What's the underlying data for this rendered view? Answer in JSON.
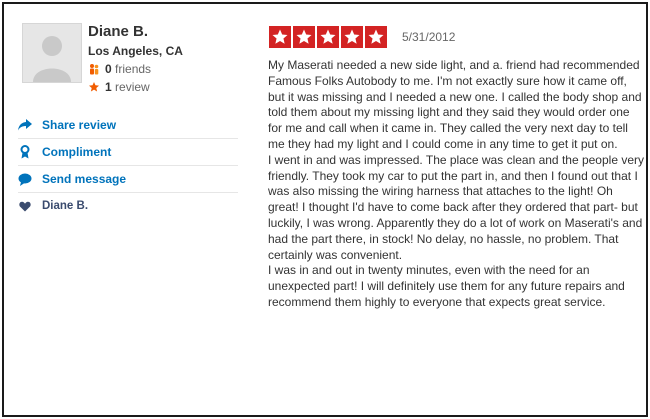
{
  "user": {
    "name": "Diane B.",
    "location": "Los Angeles, CA",
    "friends_count": "0",
    "friends_label": "friends",
    "reviews_count": "1",
    "reviews_label": "review"
  },
  "actions": [
    {
      "label": "Share review",
      "icon": "share-arrow-icon"
    },
    {
      "label": "Compliment",
      "icon": "award-ribbon-icon"
    },
    {
      "label": "Send message",
      "icon": "speech-bubble-icon"
    },
    {
      "label": "Diane B.",
      "icon": "heart-icon"
    }
  ],
  "review": {
    "rating": 5,
    "rating_max": 5,
    "date": "5/31/2012",
    "paragraphs": [
      "My Maserati needed a new side light, and a. friend had recommended Famous Folks Autobody to me. I'm not exactly sure how it came off, but it was missing and I needed a new one. I called the body shop and told them about my missing light and they said they would order one for me and call when it came in. They called the very next day to tell me they had my light and I could come in any time to get it put on.",
      "I went in and was impressed. The place was clean and the people very friendly. They took my car to put the part in, and then I found out that I was also missing the wiring harness that attaches to the light! Oh great! I thought I'd have to come back after they ordered that part- but luckily, I was wrong. Apparently they do a lot of work on Maserati's and had the part there, in stock! No delay, no hassle, no problem. That certainly was convenient.",
      "I was in and out in twenty minutes, even with the need for an unexpected part! I will definitely use them for any future repairs and recommend them highly to everyone that expects great service."
    ]
  },
  "colors": {
    "star_red": "#d32323",
    "link_blue": "#0073bb",
    "friends_orange": "#f15c00"
  }
}
